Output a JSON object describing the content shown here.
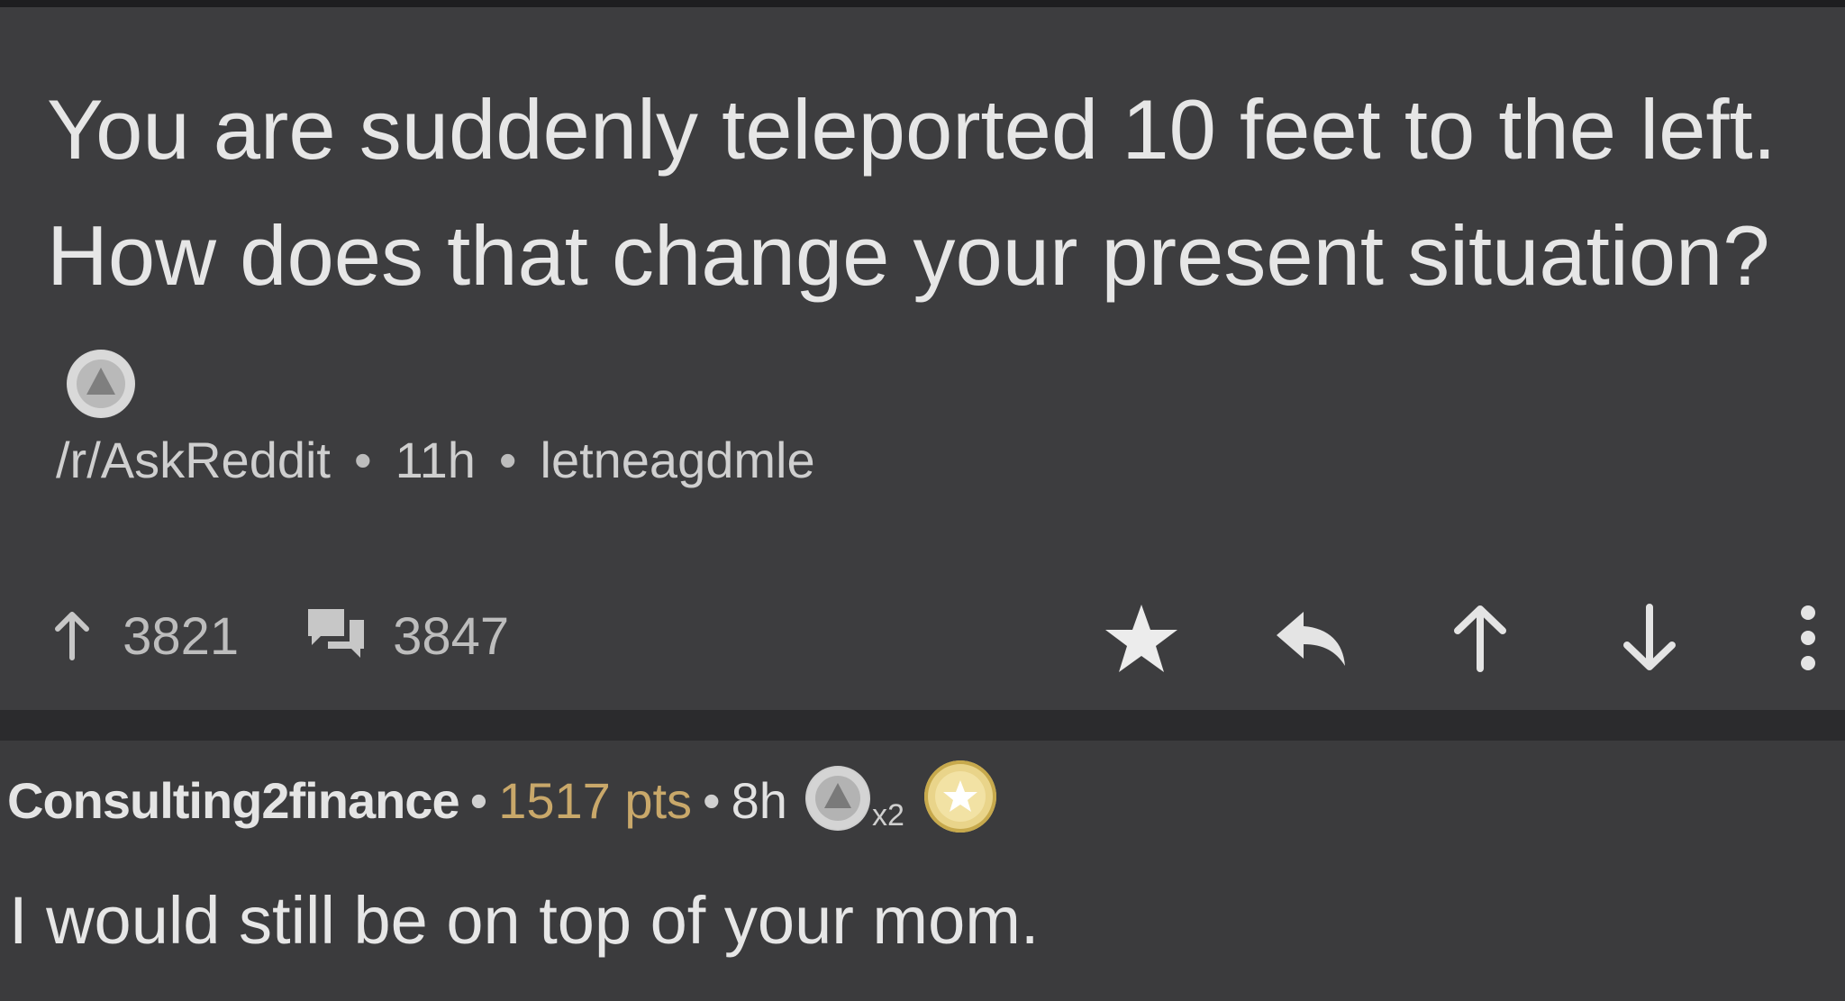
{
  "post": {
    "title": "You are suddenly teleported 10 feet to the left. How does that change your present situation?",
    "subreddit": "/r/AskReddit",
    "age": "11h",
    "author": "letneagdmle",
    "upvotes": "3821",
    "comments": "3847",
    "icons": {
      "upvote": "arrow-up-icon",
      "comments": "comment-bubbles-icon",
      "save": "star-icon",
      "reply": "reply-icon",
      "vote_up": "arrow-up-icon",
      "vote_down": "arrow-down-icon",
      "more": "more-vertical-icon",
      "title_badge": "silver-award-icon"
    }
  },
  "comment": {
    "author": "Consulting2finance",
    "points": "1517 pts",
    "age": "8h",
    "award_count": "x2",
    "body": "I would still be on top of your mom.",
    "icons": {
      "award": "silver-award-icon",
      "gold": "gold-award-icon"
    }
  },
  "colors": {
    "background": "#3b3b3d",
    "divider": "#2b2b2d",
    "text": "#e6e6e6",
    "meta_text": "#cfcfcf",
    "points": "#c9a86a",
    "gold": "#e9d48a"
  }
}
